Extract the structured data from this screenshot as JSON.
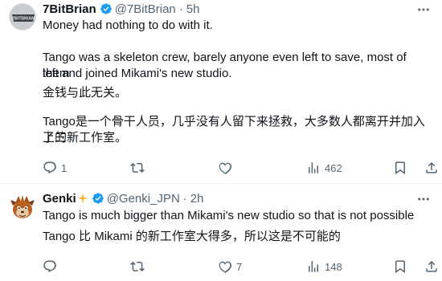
{
  "tweets": [
    {
      "name": "7BitBrian",
      "handle": "@7BitBrian",
      "time": "5h",
      "avatar_text": "7BITBRIAN",
      "text": [
        "Money had nothing to do with it.",
        "Tango was a skeleton crew, barely anyone even left to save, most of them",
        "left and joined Mikami's new studio.",
        "金钱与此无关。",
        "Tango是一个骨干人员，几乎没有人留下来拯救，大多数人都离开并加入了三",
        "上的新工作室。"
      ],
      "actions": {
        "replies": "1",
        "reposts": "",
        "likes": "",
        "views": "462"
      }
    },
    {
      "name": "Genki",
      "handle": "@Genki_JPN",
      "time": "2h",
      "text": [
        "Tango is much bigger than Mikami's new studio so that is not possible",
        "Tango 比 Mikami 的新工作室大得多，所以这是不可能的"
      ],
      "actions": {
        "replies": "",
        "reposts": "",
        "likes": "7",
        "views": "148"
      }
    }
  ],
  "icons": [
    "verified-badge-icon",
    "sparkle-icon",
    "more-icon",
    "reply-icon",
    "repost-icon",
    "like-icon",
    "views-icon",
    "bookmark-icon",
    "share-icon"
  ],
  "colors": {
    "verified": "#1d9bf0",
    "text": "#0f1419",
    "secondary": "#536471",
    "sparkle": "#ffb02e"
  }
}
